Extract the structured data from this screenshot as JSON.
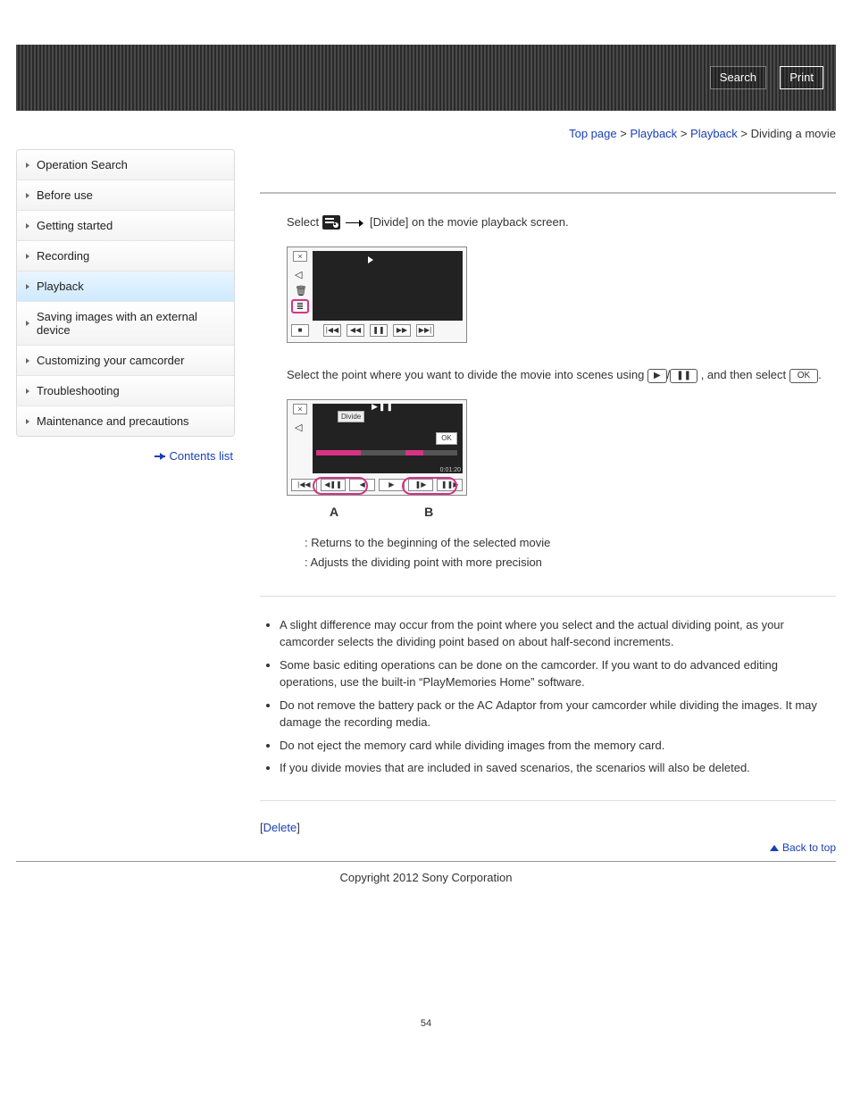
{
  "topbar": {
    "search": "Search",
    "print": "Print"
  },
  "breadcrumb": {
    "top": "Top page",
    "c1": "Playback",
    "c2": "Playback",
    "current": "Dividing a movie",
    "sep": ">"
  },
  "nav": {
    "items": [
      {
        "label": "Operation Search"
      },
      {
        "label": "Before use"
      },
      {
        "label": "Getting started"
      },
      {
        "label": "Recording"
      },
      {
        "label": "Playback",
        "active": true
      },
      {
        "label": "Saving images with an external device"
      },
      {
        "label": "Customizing your camcorder"
      },
      {
        "label": "Troubleshooting"
      },
      {
        "label": "Maintenance and precautions"
      }
    ],
    "contents_link": "Contents list"
  },
  "content": {
    "step1_pre": "Select ",
    "step1_post": " [Divide] on the movie playback screen.",
    "step2_pre": "Select the point where you want to divide the movie into scenes using ",
    "step2_mid": "/",
    "step2_post": ", and then select ",
    "step2_end": ".",
    "ok_label": "OK",
    "divide_label": "Divide",
    "d2_time": "0:01:20",
    "letterA": "A",
    "letterB": "B",
    "legendA": ": Returns to the beginning of the selected movie",
    "legendB": ": Adjusts the dividing point with more precision",
    "notes": [
      "A slight difference may occur from the point where you select and the actual dividing point, as your camcorder selects the dividing point based on about half-second increments.",
      "Some basic editing operations can be done on the camcorder. If you want to do advanced editing operations, use the built-in “PlayMemories Home” software.",
      "Do not remove the battery pack or the AC Adaptor from your camcorder while dividing the images. It may damage the recording media.",
      "Do not eject the memory card while dividing images from the memory card.",
      "If you divide movies that are included in saved scenarios, the scenarios will also be deleted."
    ],
    "related_label": "Delete",
    "backtop": "Back to top",
    "copyright": "Copyright 2012 Sony Corporation",
    "page_number": "54"
  }
}
